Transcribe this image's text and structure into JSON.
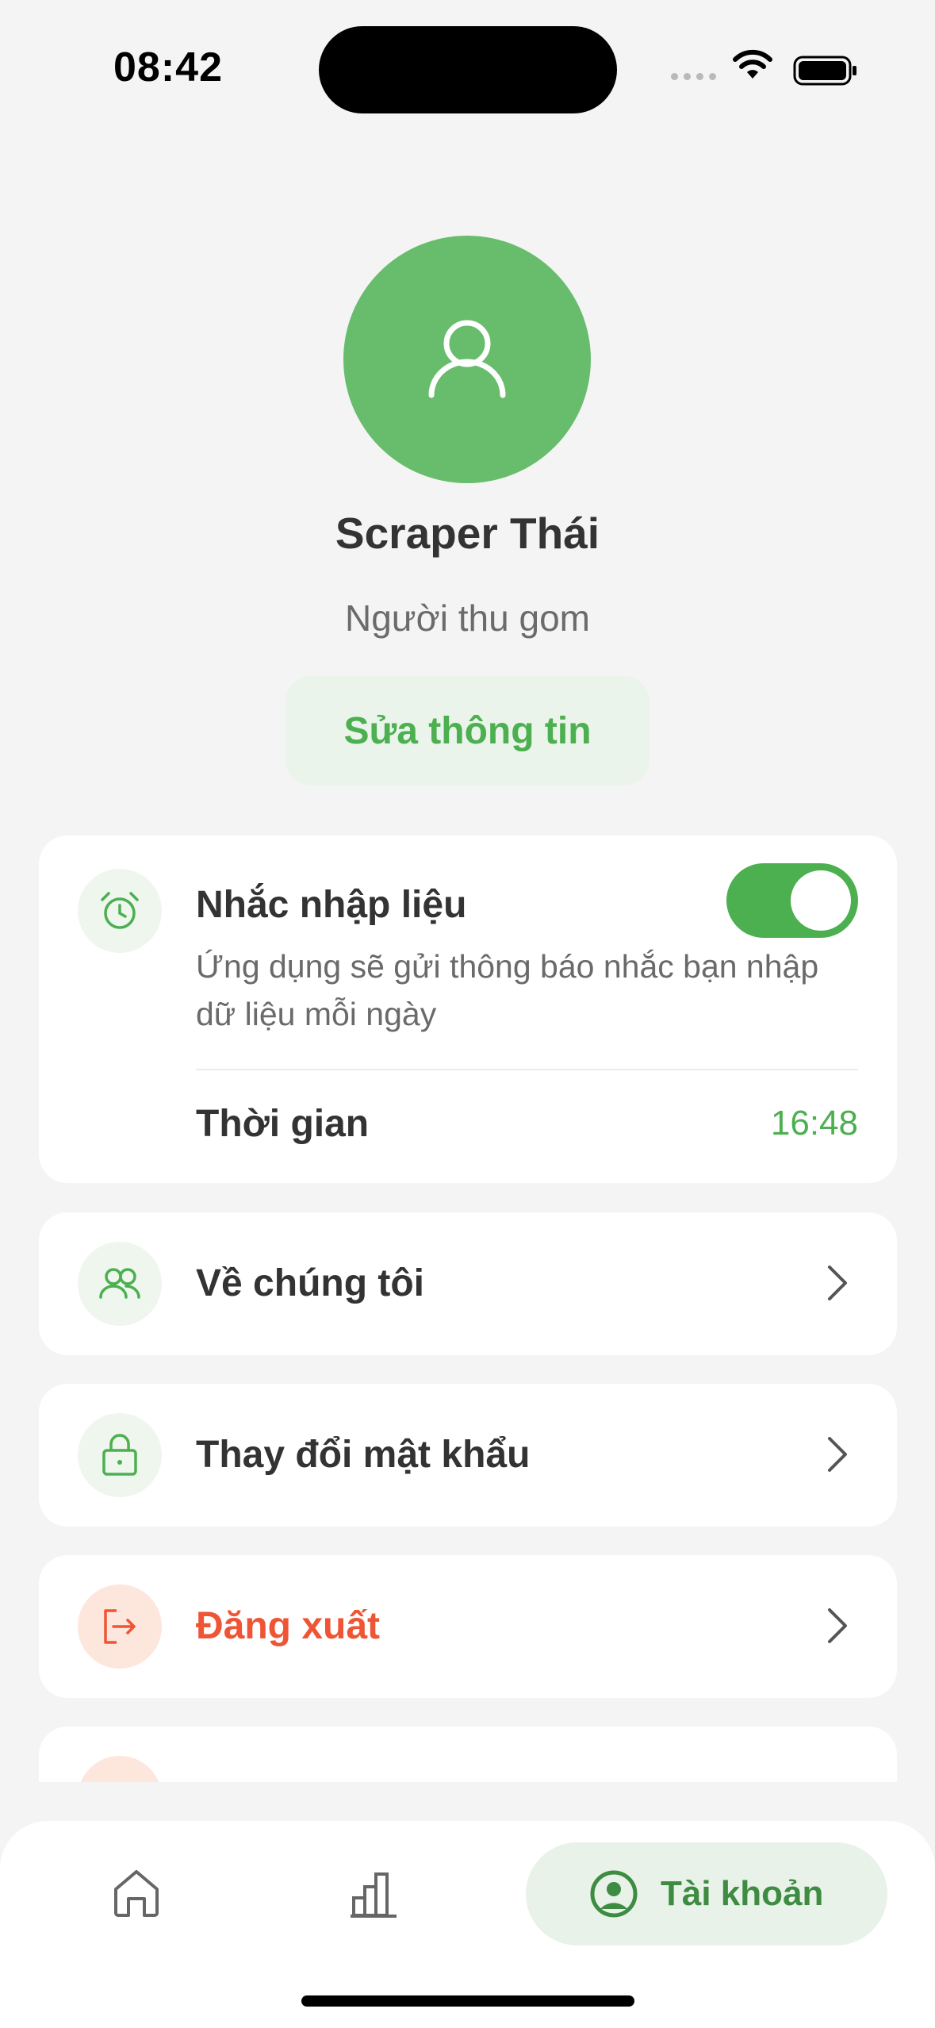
{
  "status_bar": {
    "time": "08:42"
  },
  "profile": {
    "name": "Scraper Thái",
    "role": "Người thu gom",
    "edit_label": "Sửa thông tin",
    "avatar_icon": "user-icon"
  },
  "reminder": {
    "icon": "alarm-clock-icon",
    "title": "Nhắc nhập liệu",
    "description": "Ứng dụng sẽ gửi thông báo nhắc bạn nhập dữ liệu mỗi ngày",
    "enabled": true,
    "time_label": "Thời gian",
    "time_value": "16:48"
  },
  "menu": [
    {
      "icon": "users-icon",
      "label": "Về chúng tôi"
    },
    {
      "icon": "lock-icon",
      "label": "Thay đổi mật khẩu"
    },
    {
      "icon": "logout-icon",
      "label": "Đăng xuất"
    }
  ],
  "tabbar": {
    "tabs": [
      {
        "icon": "home-icon",
        "label": ""
      },
      {
        "icon": "chart-icon",
        "label": ""
      },
      {
        "icon": "account-icon",
        "label": "Tài khoản",
        "active": true
      }
    ]
  },
  "colors": {
    "accent": "#4caf50",
    "avatar": "#68bd6c",
    "danger": "#ef5535",
    "background": "#f4f4f4"
  }
}
